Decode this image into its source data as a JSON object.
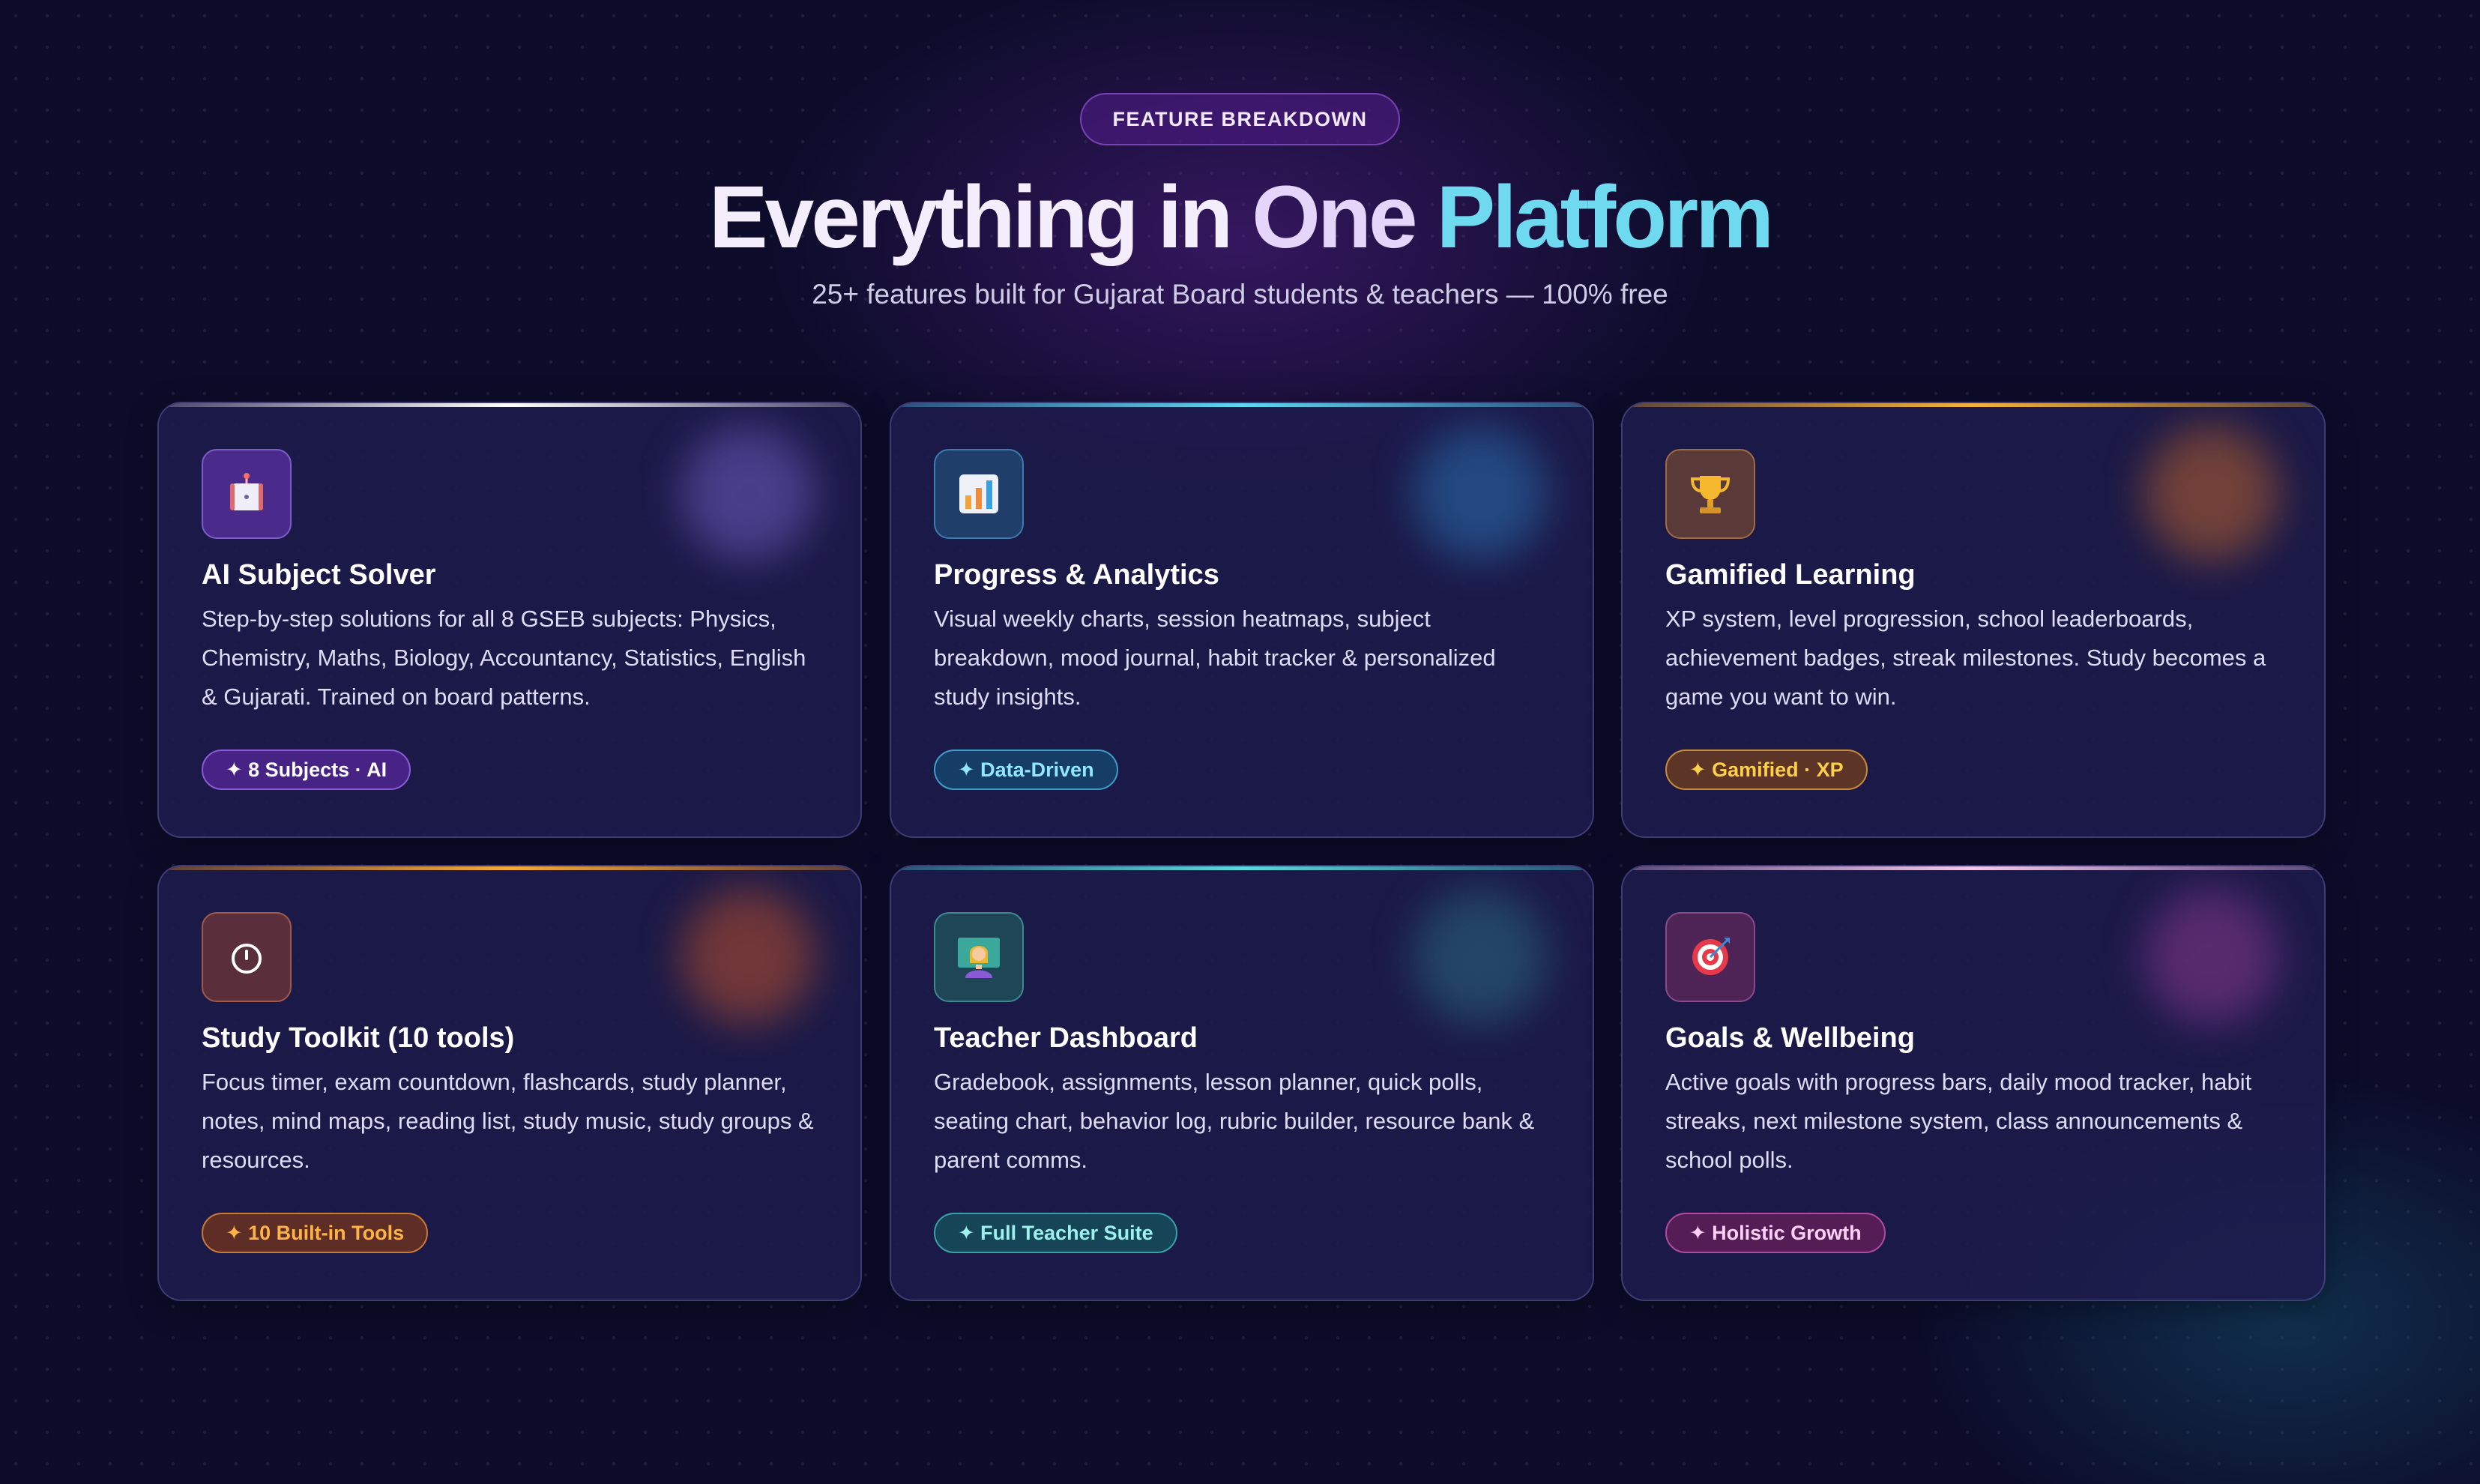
{
  "header": {
    "eyebrow": "FEATURE BREAKDOWN",
    "title_part1": "Everything in ",
    "title_part2": "One ",
    "title_part3": "Platform",
    "subtitle": "25+ features built for Gujarat Board students & teachers — 100% free"
  },
  "features": [
    {
      "icon": "robot-icon",
      "title": "AI Subject Solver",
      "description": "Step-by-step solutions for all 8 GSEB subjects: Physics, Chemistry, Maths, Biology, Accountancy, Statistics, English & Gujarati. Trained on board patterns.",
      "tag": "✦ 8 Subjects · AI",
      "accent": "#8a5ad8"
    },
    {
      "icon": "bar-chart-icon",
      "title": "Progress & Analytics",
      "description": "Visual weekly charts, session heatmaps, subject breakdown, mood journal, habit tracker & personalized study insights.",
      "tag": "✦ Data-Driven",
      "accent": "#5fd6f2"
    },
    {
      "icon": "trophy-icon",
      "title": "Gamified Learning",
      "description": "XP system, level progression, school leaderboards, achievement badges, streak milestones. Study becomes a game you want to win.",
      "tag": "✦ Gamified · XP",
      "accent": "#f5b33a"
    },
    {
      "icon": "timer-icon",
      "title": "Study Toolkit (10 tools)",
      "description": "Focus timer, exam countdown, flashcards, study planner, notes, mind maps, reading list, study music, study groups & resources.",
      "tag": "✦ 10 Built-in Tools",
      "accent": "#f5a93a"
    },
    {
      "icon": "teacher-icon",
      "title": "Teacher Dashboard",
      "description": "Gradebook, assignments, lesson planner, quick polls, seating chart, behavior log, rubric builder, resource bank & parent comms.",
      "tag": "✦ Full Teacher Suite",
      "accent": "#5ad8e0"
    },
    {
      "icon": "target-icon",
      "title": "Goals & Wellbeing",
      "description": "Active goals with progress bars, daily mood tracker, habit streaks, next milestone system, class announcements & school polls.",
      "tag": "✦ Holistic Growth",
      "accent": "#f3c8ef"
    }
  ]
}
